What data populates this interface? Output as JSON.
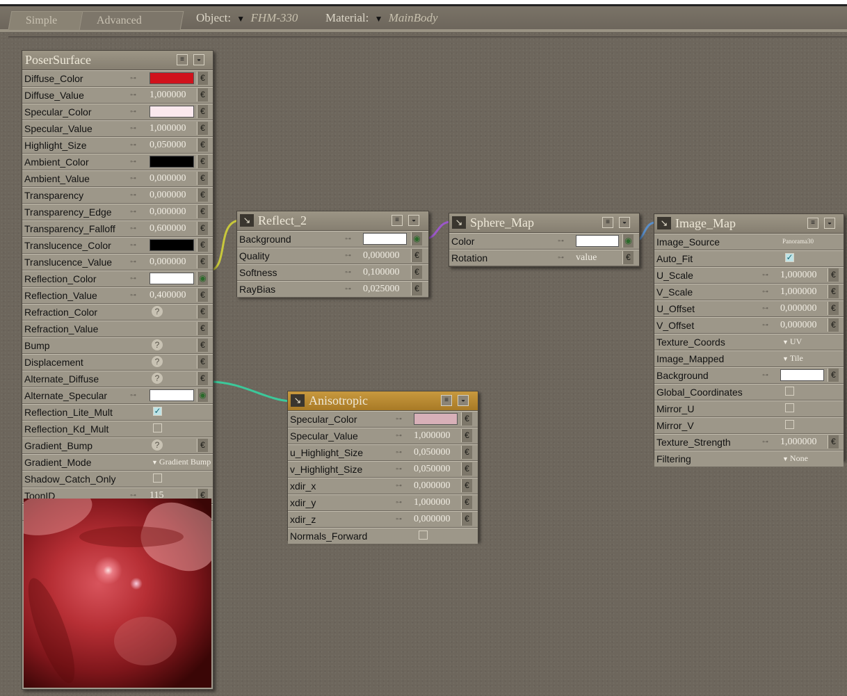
{
  "tabs": [
    {
      "label": "Simple"
    },
    {
      "label": "Advanced"
    }
  ],
  "object_selector": {
    "label": "Object:",
    "value": "FHM-330"
  },
  "material_selector": {
    "label": "Material:",
    "value": "MainBody"
  },
  "icons": {
    "node_type": "node-type-icon",
    "menu": "node-menu-icon",
    "collapse": "node-collapse-icon",
    "link": "parameter-link-icon",
    "plug": "input-plug-icon",
    "help": "help-icon",
    "dropdown": "dropdown-arrow-icon"
  },
  "poser_surface": {
    "title": "PoserSurface",
    "rows": [
      {
        "label": "Diffuse_Color",
        "kind": "color",
        "color": "#d0121c"
      },
      {
        "label": "Diffuse_Value",
        "kind": "value",
        "value": "1,000000"
      },
      {
        "label": "Specular_Color",
        "kind": "color",
        "color": "#fbe9ee"
      },
      {
        "label": "Specular_Value",
        "kind": "value",
        "value": "1,000000"
      },
      {
        "label": "Highlight_Size",
        "kind": "value",
        "value": "0,050000"
      },
      {
        "label": "Ambient_Color",
        "kind": "color",
        "color": "#000000"
      },
      {
        "label": "Ambient_Value",
        "kind": "value",
        "value": "0,000000"
      },
      {
        "label": "Transparency",
        "kind": "value",
        "value": "0,000000"
      },
      {
        "label": "Transparency_Edge",
        "kind": "value",
        "value": "0,000000"
      },
      {
        "label": "Transparency_Falloff",
        "kind": "value",
        "value": "0,600000"
      },
      {
        "label": "Translucence_Color",
        "kind": "color",
        "color": "#000000"
      },
      {
        "label": "Translucence_Value",
        "kind": "value",
        "value": "0,000000"
      },
      {
        "label": "Reflection_Color",
        "kind": "color",
        "color": "#ffffff"
      },
      {
        "label": "Reflection_Value",
        "kind": "value",
        "value": "0,400000"
      },
      {
        "label": "Refraction_Color",
        "kind": "help"
      },
      {
        "label": "Refraction_Value",
        "kind": "empty"
      },
      {
        "label": "Bump",
        "kind": "help"
      },
      {
        "label": "Displacement",
        "kind": "help"
      },
      {
        "label": "Alternate_Diffuse",
        "kind": "help"
      },
      {
        "label": "Alternate_Specular",
        "kind": "color",
        "color": "#ffffff"
      },
      {
        "label": "Reflection_Lite_Mult",
        "kind": "check",
        "checked": true
      },
      {
        "label": "Reflection_Kd_Mult",
        "kind": "check",
        "checked": false
      },
      {
        "label": "Gradient_Bump",
        "kind": "help"
      },
      {
        "label": "Gradient_Mode",
        "kind": "dropdown",
        "value": "Gradient Bump"
      },
      {
        "label": "Shadow_Catch_Only",
        "kind": "check",
        "checked": false
      },
      {
        "label": "ToonID",
        "kind": "value",
        "value": "115"
      },
      {
        "label": "Normals_Forward",
        "kind": "check",
        "checked": false
      }
    ]
  },
  "reflect": {
    "title": "Reflect_2",
    "rows": [
      {
        "label": "Background",
        "kind": "color",
        "color": "#ffffff"
      },
      {
        "label": "Quality",
        "kind": "value",
        "value": "0,000000"
      },
      {
        "label": "Softness",
        "kind": "value",
        "value": "0,100000"
      },
      {
        "label": "RayBias",
        "kind": "value",
        "value": "0,025000"
      }
    ]
  },
  "sphere_map": {
    "title": "Sphere_Map",
    "rows": [
      {
        "label": "Color",
        "kind": "color",
        "color": "#ffffff"
      },
      {
        "label": "Rotation",
        "kind": "text",
        "value": "value"
      }
    ]
  },
  "image_map": {
    "title": "Image_Map",
    "rows": [
      {
        "label": "Image_Source",
        "kind": "small",
        "value": "Panorama30"
      },
      {
        "label": "Auto_Fit",
        "kind": "check",
        "checked": true
      },
      {
        "label": "U_Scale",
        "kind": "value",
        "value": "1,000000"
      },
      {
        "label": "V_Scale",
        "kind": "value",
        "value": "1,000000"
      },
      {
        "label": "U_Offset",
        "kind": "value",
        "value": "0,000000"
      },
      {
        "label": "V_Offset",
        "kind": "value",
        "value": "0,000000"
      },
      {
        "label": "Texture_Coords",
        "kind": "dropdown",
        "value": "UV"
      },
      {
        "label": "Image_Mapped",
        "kind": "dropdown",
        "value": "Tile"
      },
      {
        "label": "Background",
        "kind": "color",
        "color": "#ffffff"
      },
      {
        "label": "Global_Coordinates",
        "kind": "check",
        "checked": false
      },
      {
        "label": "Mirror_U",
        "kind": "check",
        "checked": false
      },
      {
        "label": "Mirror_V",
        "kind": "check",
        "checked": false
      },
      {
        "label": "Texture_Strength",
        "kind": "value",
        "value": "1,000000"
      },
      {
        "label": "Filtering",
        "kind": "dropdown",
        "value": "None"
      }
    ]
  },
  "anisotropic": {
    "title": "Anisotropic",
    "rows": [
      {
        "label": "Specular_Color",
        "kind": "color",
        "color": "#d8b0b8"
      },
      {
        "label": "Specular_Value",
        "kind": "value",
        "value": "1,000000"
      },
      {
        "label": "u_Highlight_Size",
        "kind": "value",
        "value": "0,050000"
      },
      {
        "label": "v_Highlight_Size",
        "kind": "value",
        "value": "0,050000"
      },
      {
        "label": "xdir_x",
        "kind": "value",
        "value": "0,000000"
      },
      {
        "label": "xdir_y",
        "kind": "value",
        "value": "1,000000"
      },
      {
        "label": "xdir_z",
        "kind": "value",
        "value": "0,000000"
      },
      {
        "label": "Normals_Forward",
        "kind": "check",
        "checked": false
      }
    ]
  },
  "wire_colors": {
    "reflect_to_surface": "#c8c83c",
    "sphere_to_reflect": "#9b58c8",
    "image_to_sphere": "#5a8ec8",
    "aniso_to_surface": "#3cc89a"
  }
}
